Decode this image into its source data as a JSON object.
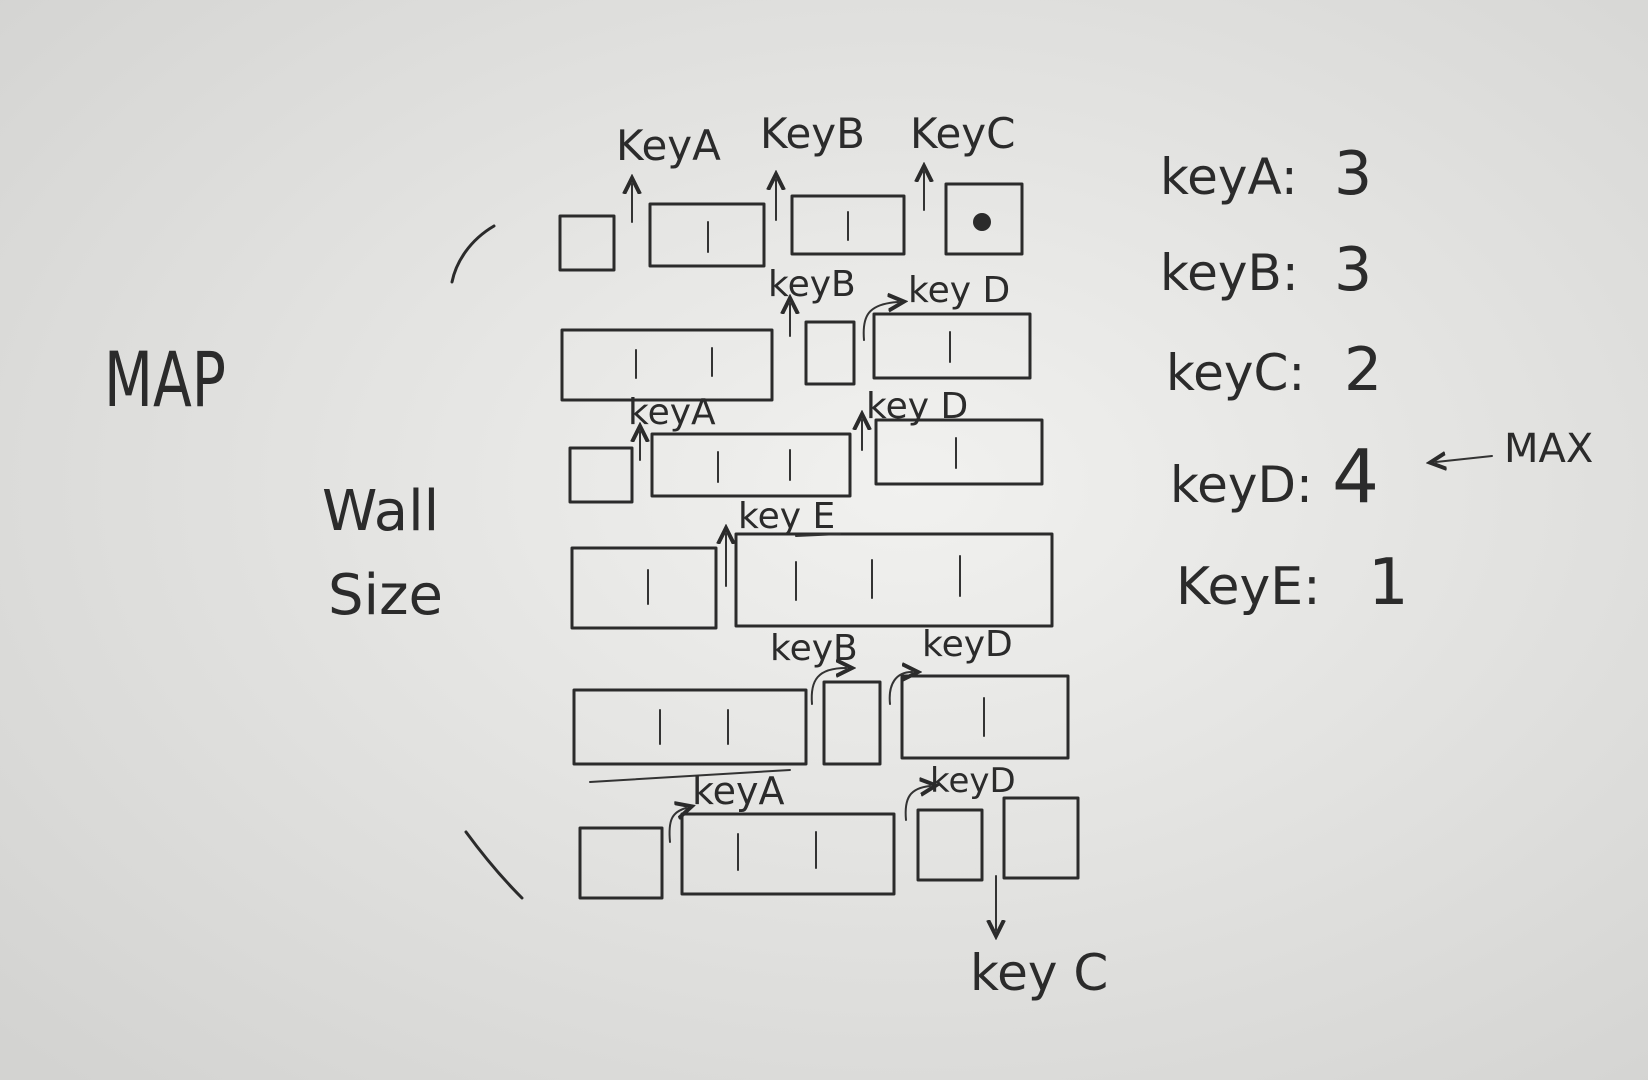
{
  "map_label": "MAP",
  "wall_label_line1": "Wall",
  "wall_label_line2": "Size",
  "rows": [
    {
      "keys": [
        "KeyA",
        "KeyB",
        "KeyC"
      ]
    },
    {
      "keys": [
        "keyB",
        "key D"
      ]
    },
    {
      "keys": [
        "keyA",
        "key D"
      ]
    },
    {
      "keys": [
        "key E"
      ]
    },
    {
      "keys": [
        "keyB",
        "keyD"
      ]
    },
    {
      "keys": [
        "keyA",
        "keyD"
      ]
    }
  ],
  "bottom_key": "key C",
  "counts": [
    {
      "label": "keyA:",
      "value": "3"
    },
    {
      "label": "keyB:",
      "value": "3"
    },
    {
      "label": "keyC:",
      "value": "2"
    },
    {
      "label": "keyD:",
      "value": "4"
    },
    {
      "label": "KeyE:",
      "value": "1"
    }
  ],
  "max_marker": "MAX",
  "colors": {
    "paper": "#e4e4e2",
    "ink": "#2b2b2b"
  }
}
